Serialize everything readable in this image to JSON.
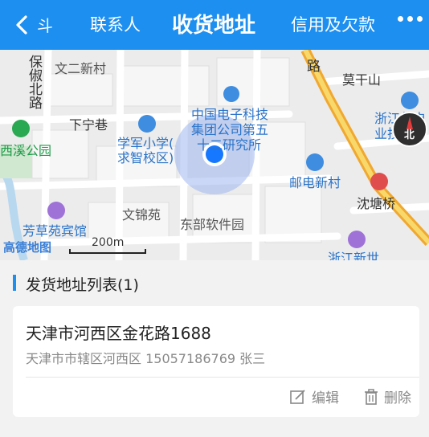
{
  "header": {
    "back_label": "<",
    "tab_left_partial": "斗",
    "tab_contacts": "联系人",
    "title": "收货地址",
    "tab_credit": "信用及欠款",
    "colors": {
      "bar": "#1d8ff0",
      "text": "#ffffff"
    }
  },
  "map": {
    "labels": {
      "wenersincun": "文二新村",
      "baochubeilu": "保俶北路",
      "xianing": "下宁巷",
      "cetc_line1": "中国电子科技",
      "cetc_line2": "集团公司第五",
      "cetc_line3": "十二研究所",
      "xuejun_line1": "学军小学(",
      "xuejun_line2": "求智校区)",
      "youdianxincun": "邮电新村",
      "wenjinyuan": "文锦苑",
      "dongburuanjianyuan": "东部软件园",
      "fangcaoyuan": "芳草苑宾馆",
      "xixigongyuan": "西溪公园",
      "shentangqiao": "沈塘桥",
      "zhejiangyoudian_line1": "浙江邮电",
      "zhejiangyoudian_line2": "业技术学",
      "zhejiangxinshi": "浙江新世",
      "mogansan": "莫干山",
      "road_lu": "路",
      "compass_north": "北",
      "scale": "200m",
      "logo": "高德地图"
    }
  },
  "section": {
    "title": "发货地址列表(1)"
  },
  "card": {
    "address_main": "天津市河西区金花路1688",
    "address_sub": "天津市市辖区河西区 15057186769 张三",
    "edit_label": "编辑",
    "delete_label": "删除"
  }
}
